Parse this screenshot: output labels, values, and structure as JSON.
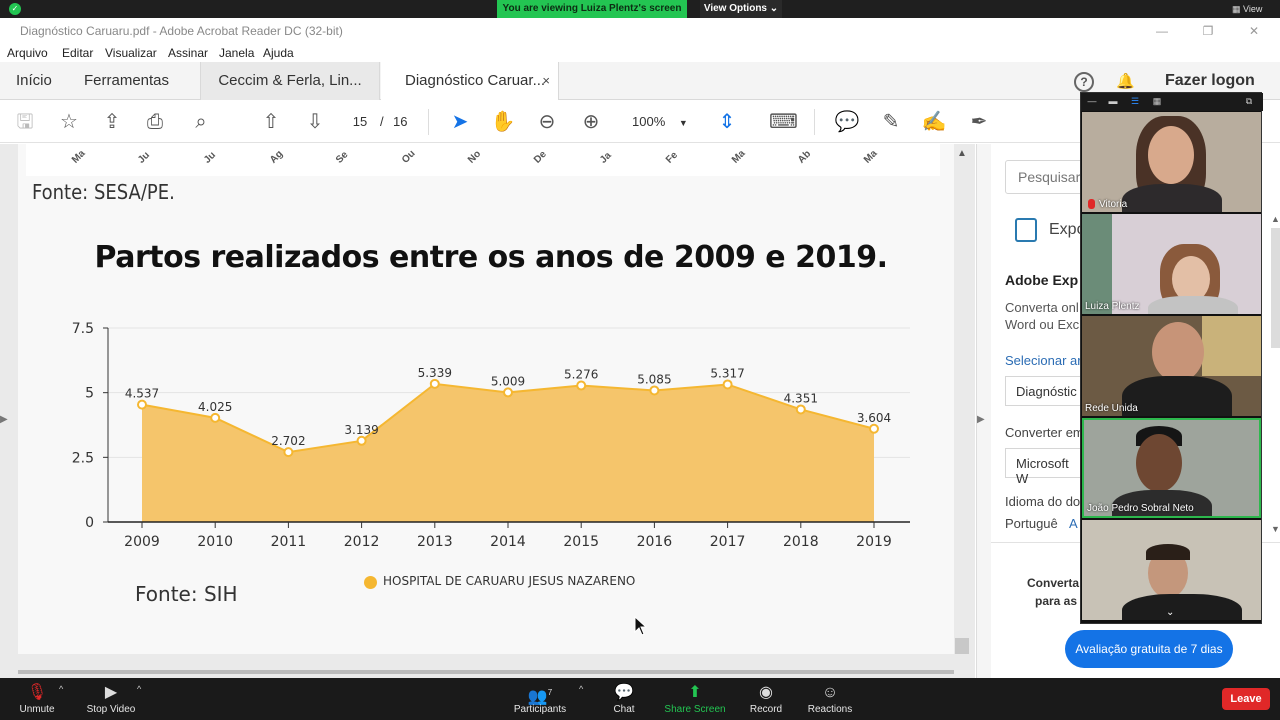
{
  "zoom": {
    "share_banner": "You are viewing Luiza Plentz's screen",
    "view_options": "View Options",
    "view_label": "View",
    "bottom": {
      "unmute": "Unmute",
      "stop_video": "Stop Video",
      "participants": "Participants",
      "participants_count": "7",
      "chat": "Chat",
      "share_screen": "Share Screen",
      "record": "Record",
      "reactions": "Reactions",
      "leave": "Leave"
    },
    "gallery": [
      {
        "name": "Vitoria",
        "muted": true
      },
      {
        "name": "Luiza Plentz",
        "muted": false
      },
      {
        "name": "Rede Unida",
        "muted": false
      },
      {
        "name": "João Pedro Sobral Neto",
        "muted": false
      },
      {
        "name": "",
        "muted": false
      }
    ]
  },
  "acrobat": {
    "window_title": "Diagnóstico Caruaru.pdf - Adobe Acrobat Reader DC (32-bit)",
    "menu": [
      "Arquivo",
      "Editar",
      "Visualizar",
      "Assinar",
      "Janela",
      "Ajuda"
    ],
    "tabs": {
      "inicio": "Início",
      "ferramentas": "Ferramentas",
      "doc1": "Ceccim & Ferla, Lin...",
      "doc2": "Diagnóstico Caruar...",
      "close": "×"
    },
    "fazer_logon": "Fazer logon",
    "help": "?",
    "page_current": "15",
    "page_sep": "/",
    "page_total": "16",
    "zoom_level": "100%",
    "right_panel": {
      "search_placeholder": "Pesquisar",
      "export": "Expo",
      "adobe_title": "Adobe Exp",
      "desc1": "Converta onl",
      "desc2": "Word ou Exc",
      "select_label": "Selecionar ar",
      "file_value": "Diagnóstic",
      "convert_label": "Converter em",
      "format_value": "Microsoft W",
      "lang_label": "Idioma do do",
      "lang_value": "Portuguê",
      "lang_link": "A",
      "convert_promo1": "Converta",
      "convert_promo2": "para as",
      "trial_button": "Avaliação gratuita de 7 dias"
    }
  },
  "document": {
    "prev_months": [
      "Ma",
      "Ju",
      "Ju",
      "Ag",
      "Se",
      "Ou",
      "No",
      "De",
      "Ja",
      "Fe",
      "Ma",
      "Ab",
      "Ma"
    ],
    "fonte_prev": "Fonte: SESA/PE.",
    "fonte_sih": "Fonte: SIH",
    "legend": "HOSPITAL DE CARUARU JESUS NAZARENO"
  },
  "chart_data": {
    "type": "area",
    "title": "Partos realizados entre os anos de 2009 e 2019.",
    "x": [
      "2009",
      "2010",
      "2011",
      "2012",
      "2013",
      "2014",
      "2015",
      "2016",
      "2017",
      "2018",
      "2019"
    ],
    "series": [
      {
        "name": "HOSPITAL DE CARUARU JESUS NAZARENO",
        "values": [
          4.537,
          4.025,
          2.702,
          3.139,
          5.339,
          5.009,
          5.276,
          5.085,
          5.317,
          4.351,
          3.604
        ],
        "labels": [
          "4.537",
          "4.025",
          "2.702",
          "3.139",
          "5.339",
          "5.009",
          "5.276",
          "5.085",
          "5.317",
          "4.351",
          "3.604"
        ]
      }
    ],
    "y_ticks": [
      "0",
      "2.5",
      "5",
      "7.5"
    ],
    "ylim": [
      0,
      7.5
    ],
    "legend_position": "bottom",
    "grid": true,
    "fill_color": "#f5c56b",
    "line_color": "#f5b731"
  }
}
